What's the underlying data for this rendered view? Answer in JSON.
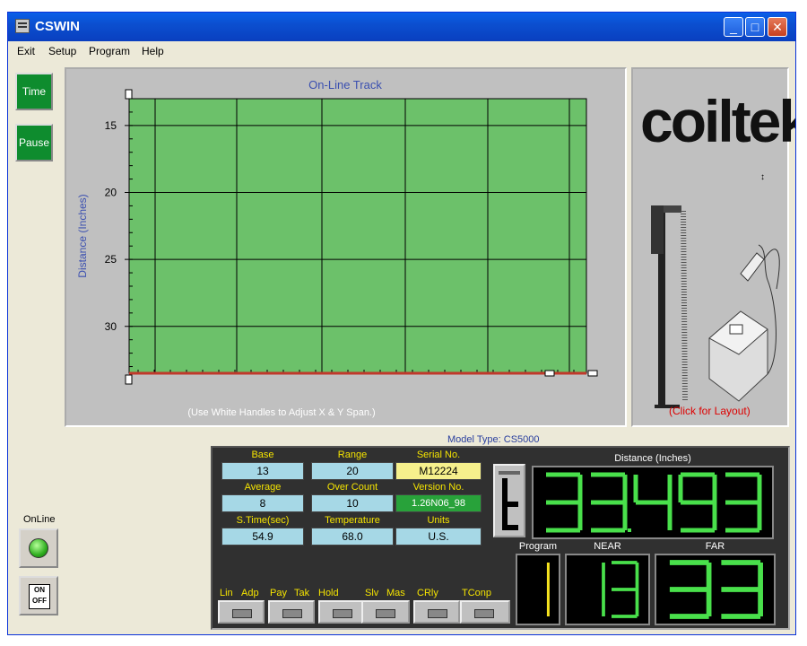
{
  "window": {
    "title": "CSWIN"
  },
  "menu": [
    "Exit",
    "Setup",
    "Program",
    "Help"
  ],
  "left": {
    "time_label": "Time",
    "pause_label": "Pause",
    "online_label": "OnLine",
    "onoff_label": "ON OFF"
  },
  "chart_data": {
    "type": "line",
    "title": "On-Line Track",
    "ylabel": "Distance (Inches)",
    "xlabel": "",
    "yticks": [
      15,
      20,
      25,
      30
    ],
    "ylim": [
      13,
      33.5
    ],
    "y_inverted": true,
    "grid": true,
    "plot_color": "#6cc16a",
    "series": [
      {
        "values": [
          33.5,
          33.5,
          33.5,
          33.5,
          33.5,
          33.5,
          33.5,
          33.5
        ],
        "color": "#c0392b"
      }
    ],
    "annotation": "(Use White Handles to Adjust X & Y Span.)"
  },
  "logo": {
    "brand": "coiltek",
    "link": "(Click for Layout)"
  },
  "model_type": "Model Type: CS5000",
  "fields": [
    {
      "label": "Base",
      "value": "13"
    },
    {
      "label": "Range",
      "value": "20"
    },
    {
      "label": "Serial No.",
      "value": "M12224"
    },
    {
      "label": "Average",
      "value": "8"
    },
    {
      "label": "Over Count",
      "value": "10"
    },
    {
      "label": "Version No.",
      "value": "1.26N06_98"
    },
    {
      "label": "S.Time(sec)",
      "value": "54.9"
    },
    {
      "label": "Temperature",
      "value": "68.0"
    },
    {
      "label": "Units",
      "value": "U.S."
    }
  ],
  "displays": {
    "distance_label": "Distance (Inches)",
    "distance_value": "33.493",
    "program_label": "Program",
    "program_value": "1",
    "near_label": "NEAR",
    "near_value": "13",
    "far_label": "FAR",
    "far_value": "33"
  },
  "toggles": [
    "Lin",
    "Adp",
    "Pay",
    "Tak",
    "Hold",
    "Slv",
    "Mas",
    "CRly",
    "TConp"
  ],
  "colors": {
    "segment": "#49e04b",
    "program_segment": "#f6e31f",
    "panel": "#303030",
    "label": "#f5e400"
  }
}
